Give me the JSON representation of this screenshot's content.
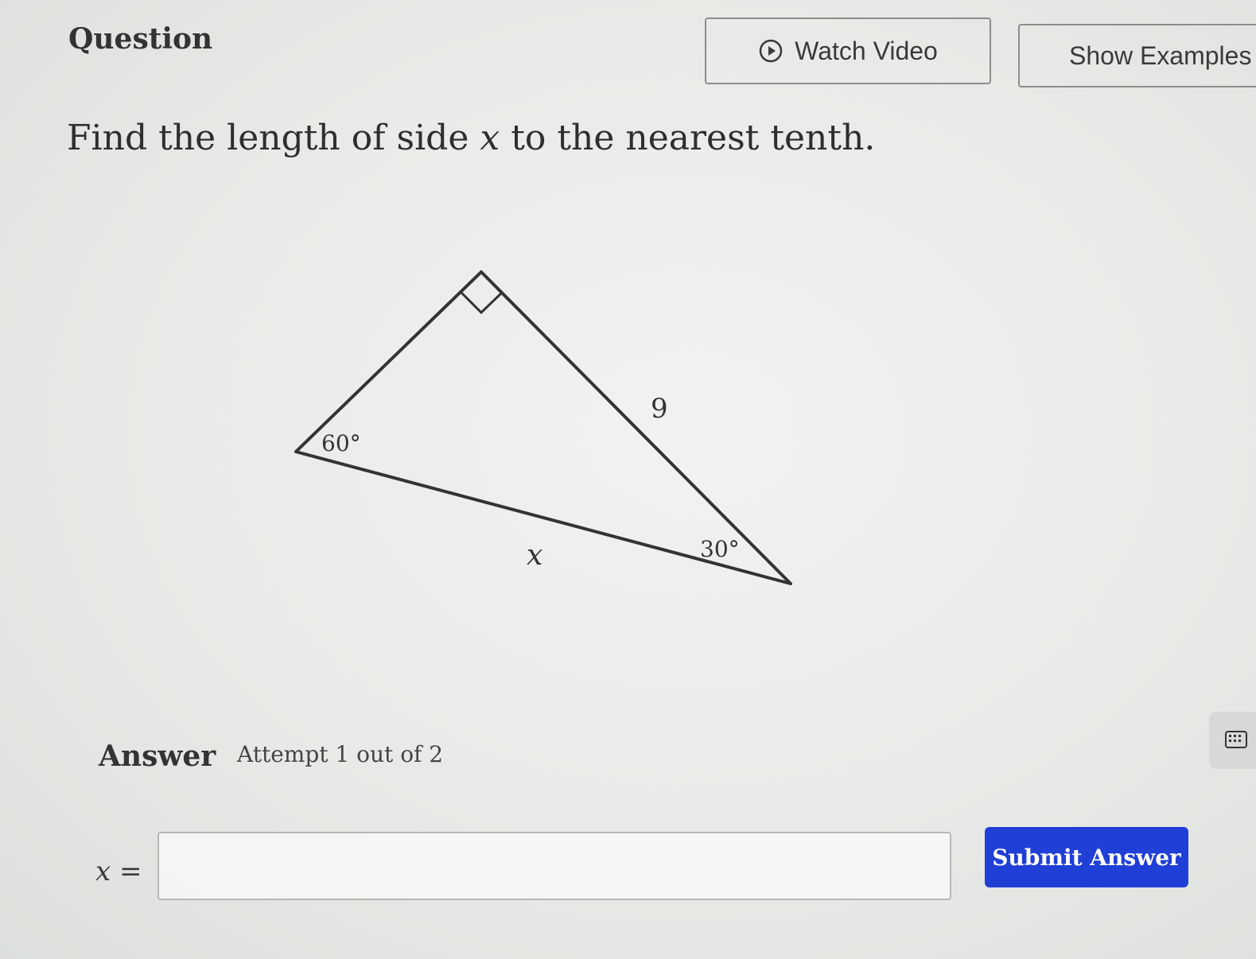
{
  "header": {
    "question_label": "Question",
    "watch_video_label": "Watch Video",
    "show_examples_label": "Show Examples"
  },
  "question": {
    "prompt_before": "Find the length of side ",
    "prompt_var": "x",
    "prompt_after": " to the nearest tenth."
  },
  "diagram": {
    "angle_top_left": "60°",
    "angle_bottom_right": "30°",
    "hypotenuse_label": "9",
    "side_label": "x"
  },
  "answer": {
    "label": "Answer",
    "attempt_text": "Attempt 1 out of 2",
    "input_prefix_var": "x",
    "input_prefix_eq": "=",
    "input_value": "",
    "submit_label": "Submit Answer"
  },
  "icons": {
    "watch_video": "play-circle-icon",
    "keypad": "keypad-icon"
  },
  "colors": {
    "submit_bg": "#1f3fd6",
    "button_border": "#8b8e8b"
  }
}
